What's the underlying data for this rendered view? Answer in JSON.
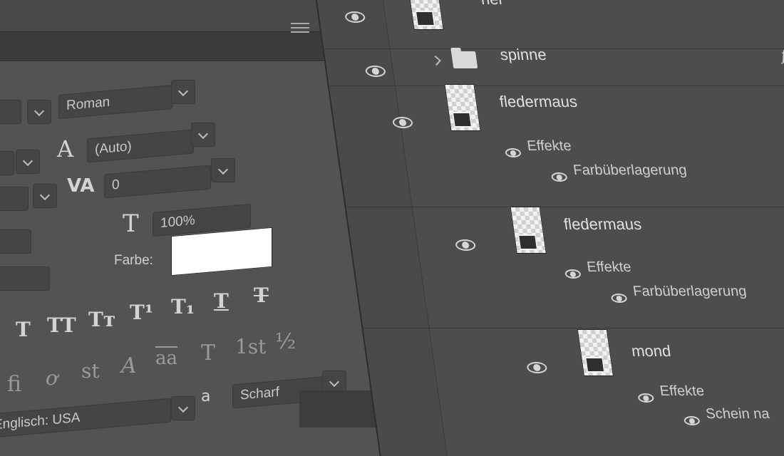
{
  "character_panel": {
    "font_style": "Roman",
    "leading": "(Auto)",
    "tracking": "0",
    "horizontal_scale": "100%",
    "color_label": "Farbe:",
    "color_value": "#ffffff",
    "type_style_buttons": [
      "T",
      "TT",
      "Tт",
      "T¹",
      "T₁",
      "T",
      "T"
    ],
    "opentype_buttons": [
      "ﬁ",
      "ơ",
      "st",
      "A",
      "aa",
      "T",
      "1st",
      "½"
    ],
    "language": "Englisch: USA",
    "antialias_icon_label": "a",
    "antialias": "Scharf"
  },
  "layers_panel": {
    "layers": [
      {
        "name": "hel"
      },
      {
        "name": "spinne",
        "type": "group"
      },
      {
        "name": "fledermaus",
        "effects_label": "Effekte",
        "effect": "Farbüberlagerung"
      },
      {
        "name": "fledermaus",
        "effects_label": "Effekte",
        "effect": "Farbüberlagerung"
      },
      {
        "name": "mond",
        "effects_label": "Effekte",
        "effect": "Schein na"
      }
    ],
    "fx_badge": "fx"
  }
}
